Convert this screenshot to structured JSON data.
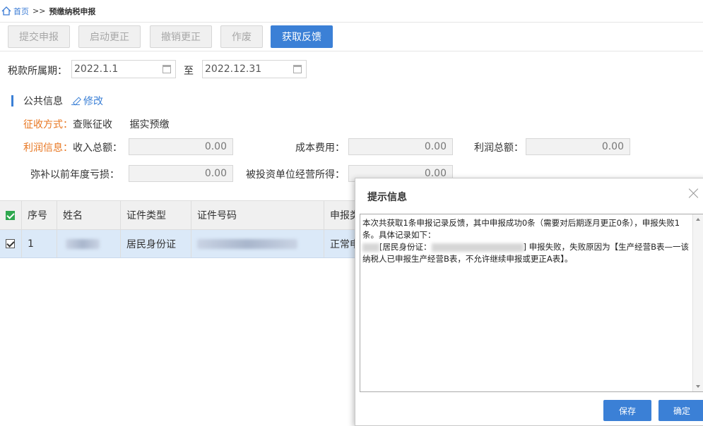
{
  "breadcrumb": {
    "home": "首页",
    "separator": ">>",
    "current": "预缴纳税申报"
  },
  "toolbar": {
    "buttons": [
      {
        "label": "提交申报",
        "enabled": false
      },
      {
        "label": "启动更正",
        "enabled": false
      },
      {
        "label": "撤销更正",
        "enabled": false
      },
      {
        "label": "作废",
        "enabled": false
      },
      {
        "label": "获取反馈",
        "enabled": true
      }
    ]
  },
  "period": {
    "label": "税款所属期：",
    "start": "2022.1.1",
    "to": "至",
    "end": "2022.12.31"
  },
  "public_info": {
    "title": "公共信息",
    "edit_label": "修改",
    "collection_label": "征收方式：",
    "collection_values": [
      "查账征收",
      "据实预缴"
    ],
    "profit_label": "利润信息：",
    "fields": [
      {
        "label": "收入总额：",
        "value": "0.00"
      },
      {
        "label": "成本费用：",
        "value": "0.00"
      },
      {
        "label": "利润总额：",
        "value": "0.00"
      },
      {
        "label": "弥补以前年度亏损：",
        "value": "0.00"
      },
      {
        "label": "被投资单位经营所得：",
        "value": "0.00"
      }
    ]
  },
  "table": {
    "headers": [
      "序号",
      "姓名",
      "证件类型",
      "证件号码",
      "申报类"
    ],
    "rows": [
      {
        "index": "1",
        "id_type": "居民身份证",
        "status": "正常申"
      }
    ]
  },
  "dialog": {
    "title": "提示信息",
    "line1": "本次共获取1条申报记录反馈，其中申报成功0条（需要对后期逐月更正0条），申报失败1条。具体记录如下：",
    "line2a": "[居民身份证：",
    "line2b": "] 申报失败，失败原因为【生产经营B表—一该纳税人已申报生产经营B表，不允许继续申报或更正A表】。",
    "save": "保存",
    "ok": "确定"
  },
  "colors": {
    "primary": "#3b80d6",
    "accent": "#e87722",
    "selected_row": "#dbe9f8"
  }
}
